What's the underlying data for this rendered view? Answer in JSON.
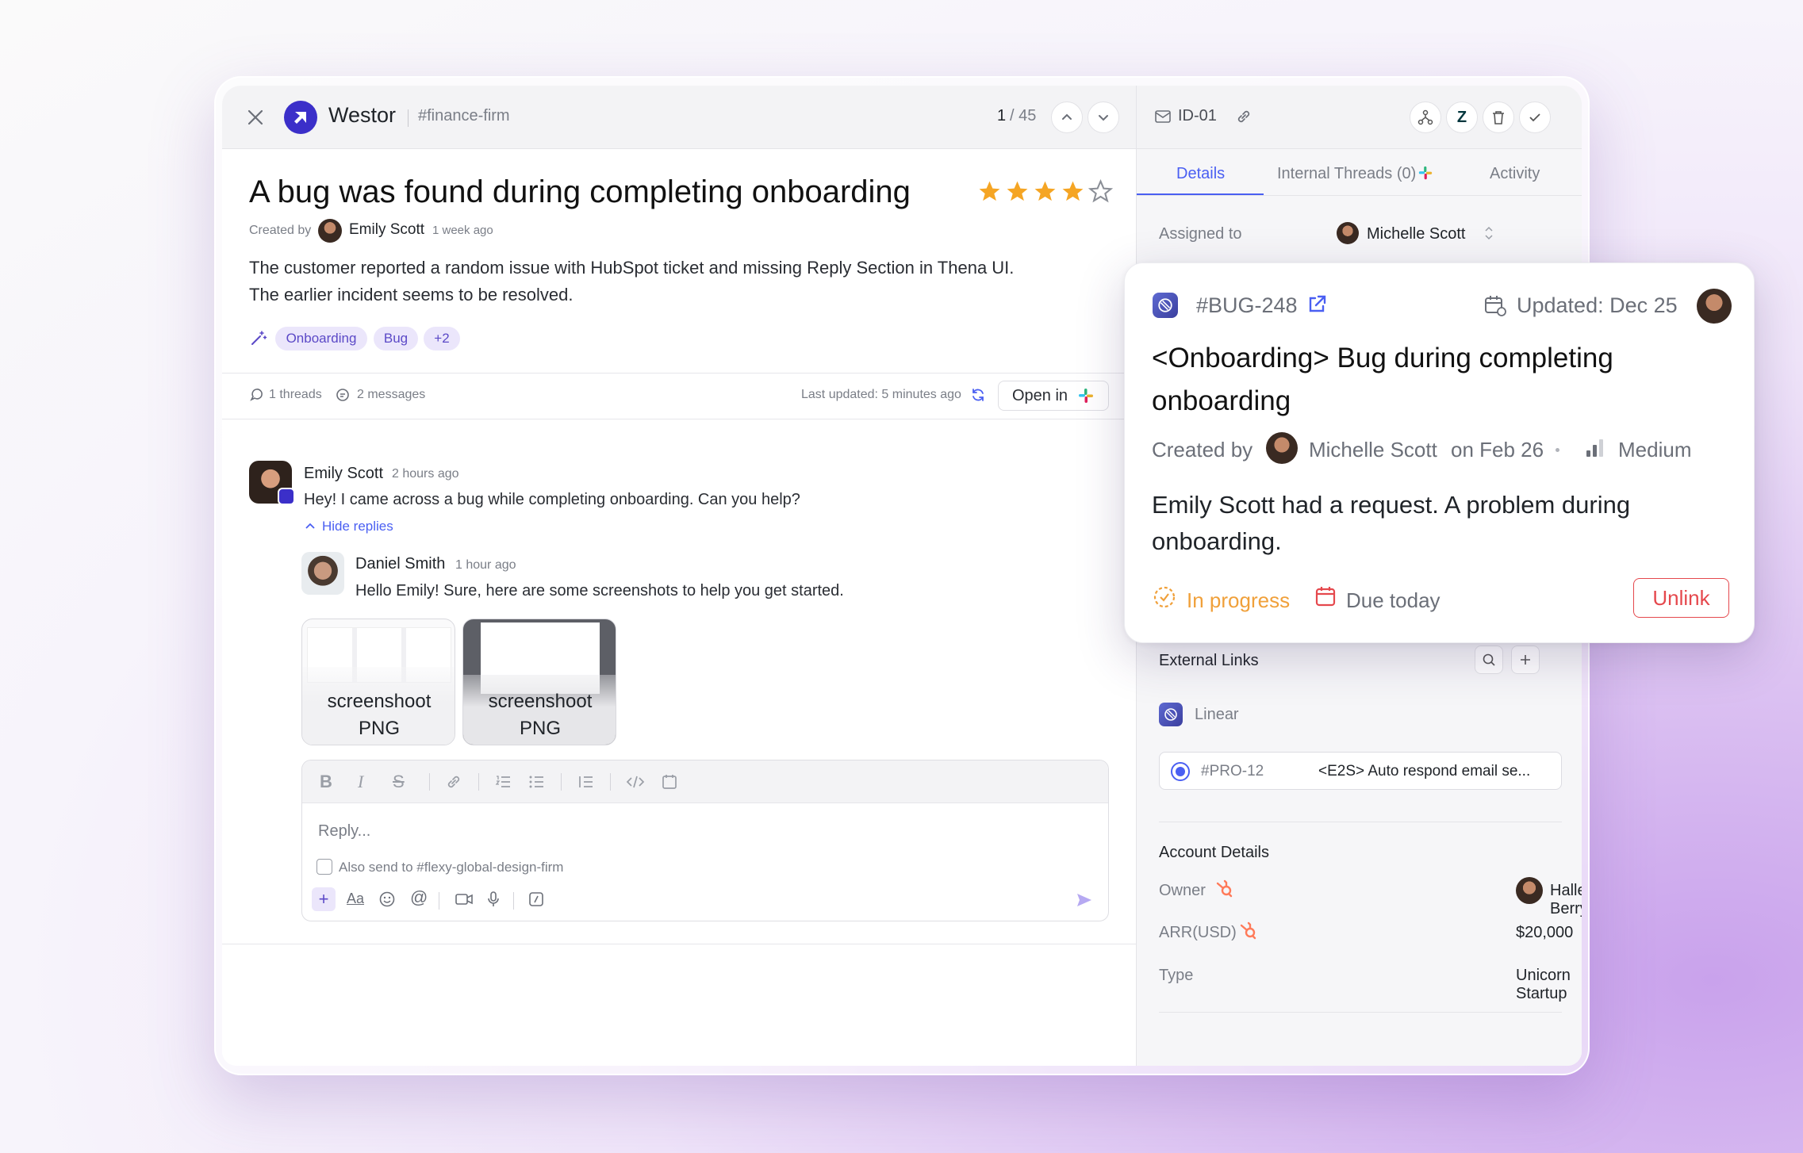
{
  "app": {
    "name": "Westor",
    "channel": "#finance-firm",
    "pager_current": "1",
    "pager_total": "/ 45"
  },
  "ticket": {
    "title": "A bug was found during completing onboarding",
    "rating": 4,
    "rating_max": 5,
    "created_by_label": "Created by",
    "author": "Emily Scott",
    "created_ago": "1 week ago",
    "description_line1": "The customer reported a random issue with HubSpot ticket and missing Reply Section in Thena UI.",
    "description_line2": "The earlier incident seems to be resolved.",
    "tags": [
      "Onboarding",
      "Bug",
      "+2"
    ],
    "threads": "1 threads",
    "messages": "2 messages",
    "last_updated": "Last updated: 5 minutes ago",
    "open_in": "Open in"
  },
  "thread": {
    "msg1": {
      "author": "Emily Scott",
      "time": "2 hours ago",
      "text": "Hey! I came across a bug while completing onboarding. Can you help?"
    },
    "hide_replies": "Hide replies",
    "msg2": {
      "author": "Daniel Smith",
      "time": "1 hour ago",
      "text": "Hello Emily! Sure, here are some screenshots to help you get started."
    },
    "attachments": [
      {
        "name": "screenshoot",
        "ext": "PNG"
      },
      {
        "name": "screenshoot",
        "ext": "PNG"
      }
    ]
  },
  "composer": {
    "placeholder": "Reply...",
    "also_send": "Also send to #flexy-global-design-firm"
  },
  "panel": {
    "id": "ID-01",
    "tabs": [
      "Details",
      "Internal Threads (0)",
      "Activity"
    ],
    "assigned_label": "Assigned to",
    "assignee": "Michelle Scott",
    "external_links": "External Links",
    "linear_label": "Linear",
    "linked_id": "#PRO-12",
    "linked_title": "<E2S> Auto respond email se...",
    "account_details": "Account Details",
    "owner_label": "Owner",
    "owner": "Halley Berry",
    "arr_label": "ARR(USD)",
    "arr": "$20,000",
    "type_label": "Type",
    "type": "Unicorn Startup"
  },
  "bug_card": {
    "id": "#BUG-248",
    "updated": "Updated: Dec 25",
    "title_line1": "<Onboarding> Bug during completing",
    "title_line2": "onboarding",
    "created_by": "Created by",
    "creator": "Michelle Scott",
    "created_on": "on Feb 26",
    "priority": "Medium",
    "desc_line1": "Emily Scott had a request. A problem during",
    "desc_line2": "onboarding.",
    "status": "In progress",
    "due": "Due today",
    "unlink": "Unlink"
  },
  "colors": {
    "accent": "#4a5ff2",
    "brand": "#3b2fc9",
    "star": "#f5a524",
    "status_orange": "#f0a03a",
    "danger": "#e5484d"
  }
}
